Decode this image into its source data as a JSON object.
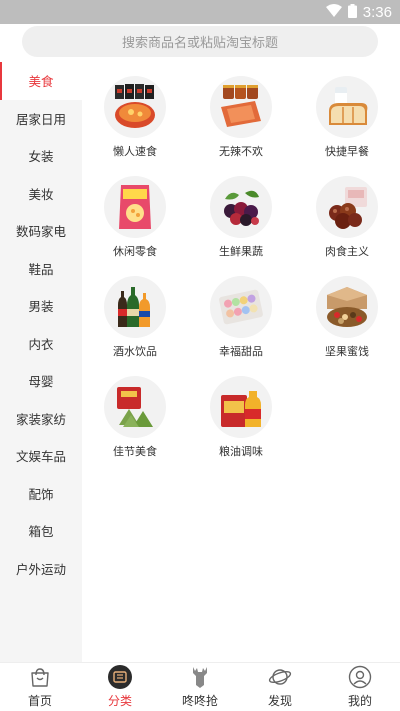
{
  "status_bar": {
    "time": "3:36"
  },
  "search": {
    "placeholder": "搜索商品名或粘贴淘宝标题"
  },
  "sidebar": {
    "items": [
      {
        "label": "美食",
        "active": true
      },
      {
        "label": "居家日用"
      },
      {
        "label": "女装"
      },
      {
        "label": "美妆"
      },
      {
        "label": "数码家电"
      },
      {
        "label": "鞋品"
      },
      {
        "label": "男装"
      },
      {
        "label": "内衣"
      },
      {
        "label": "母婴"
      },
      {
        "label": "家装家纺"
      },
      {
        "label": "文娱车品"
      },
      {
        "label": "配饰"
      },
      {
        "label": "箱包"
      },
      {
        "label": "户外运动"
      }
    ]
  },
  "categories": [
    {
      "label": "懒人速食",
      "icon": "instant-food-icon"
    },
    {
      "label": "无辣不欢",
      "icon": "spicy-food-icon"
    },
    {
      "label": "快捷早餐",
      "icon": "breakfast-icon"
    },
    {
      "label": "休闲零食",
      "icon": "snack-icon"
    },
    {
      "label": "生鲜果蔬",
      "icon": "fresh-fruit-icon"
    },
    {
      "label": "肉食主义",
      "icon": "meat-icon"
    },
    {
      "label": "酒水饮品",
      "icon": "drinks-icon"
    },
    {
      "label": "幸福甜品",
      "icon": "dessert-icon"
    },
    {
      "label": "坚果蜜饯",
      "icon": "nuts-icon"
    },
    {
      "label": "佳节美食",
      "icon": "festival-food-icon"
    },
    {
      "label": "粮油调味",
      "icon": "grain-oil-icon"
    }
  ],
  "bottom_nav": {
    "items": [
      {
        "label": "首页",
        "icon": "shopping-bag-icon"
      },
      {
        "label": "分类",
        "icon": "category-icon",
        "active": true
      },
      {
        "label": "咚咚抢",
        "icon": "deer-icon"
      },
      {
        "label": "发现",
        "icon": "planet-icon"
      },
      {
        "label": "我的",
        "icon": "user-icon"
      }
    ]
  },
  "colors": {
    "accent": "#e8383d",
    "sidebar_bg": "#f5f5f5",
    "status_bar": "#bdbdbd"
  }
}
